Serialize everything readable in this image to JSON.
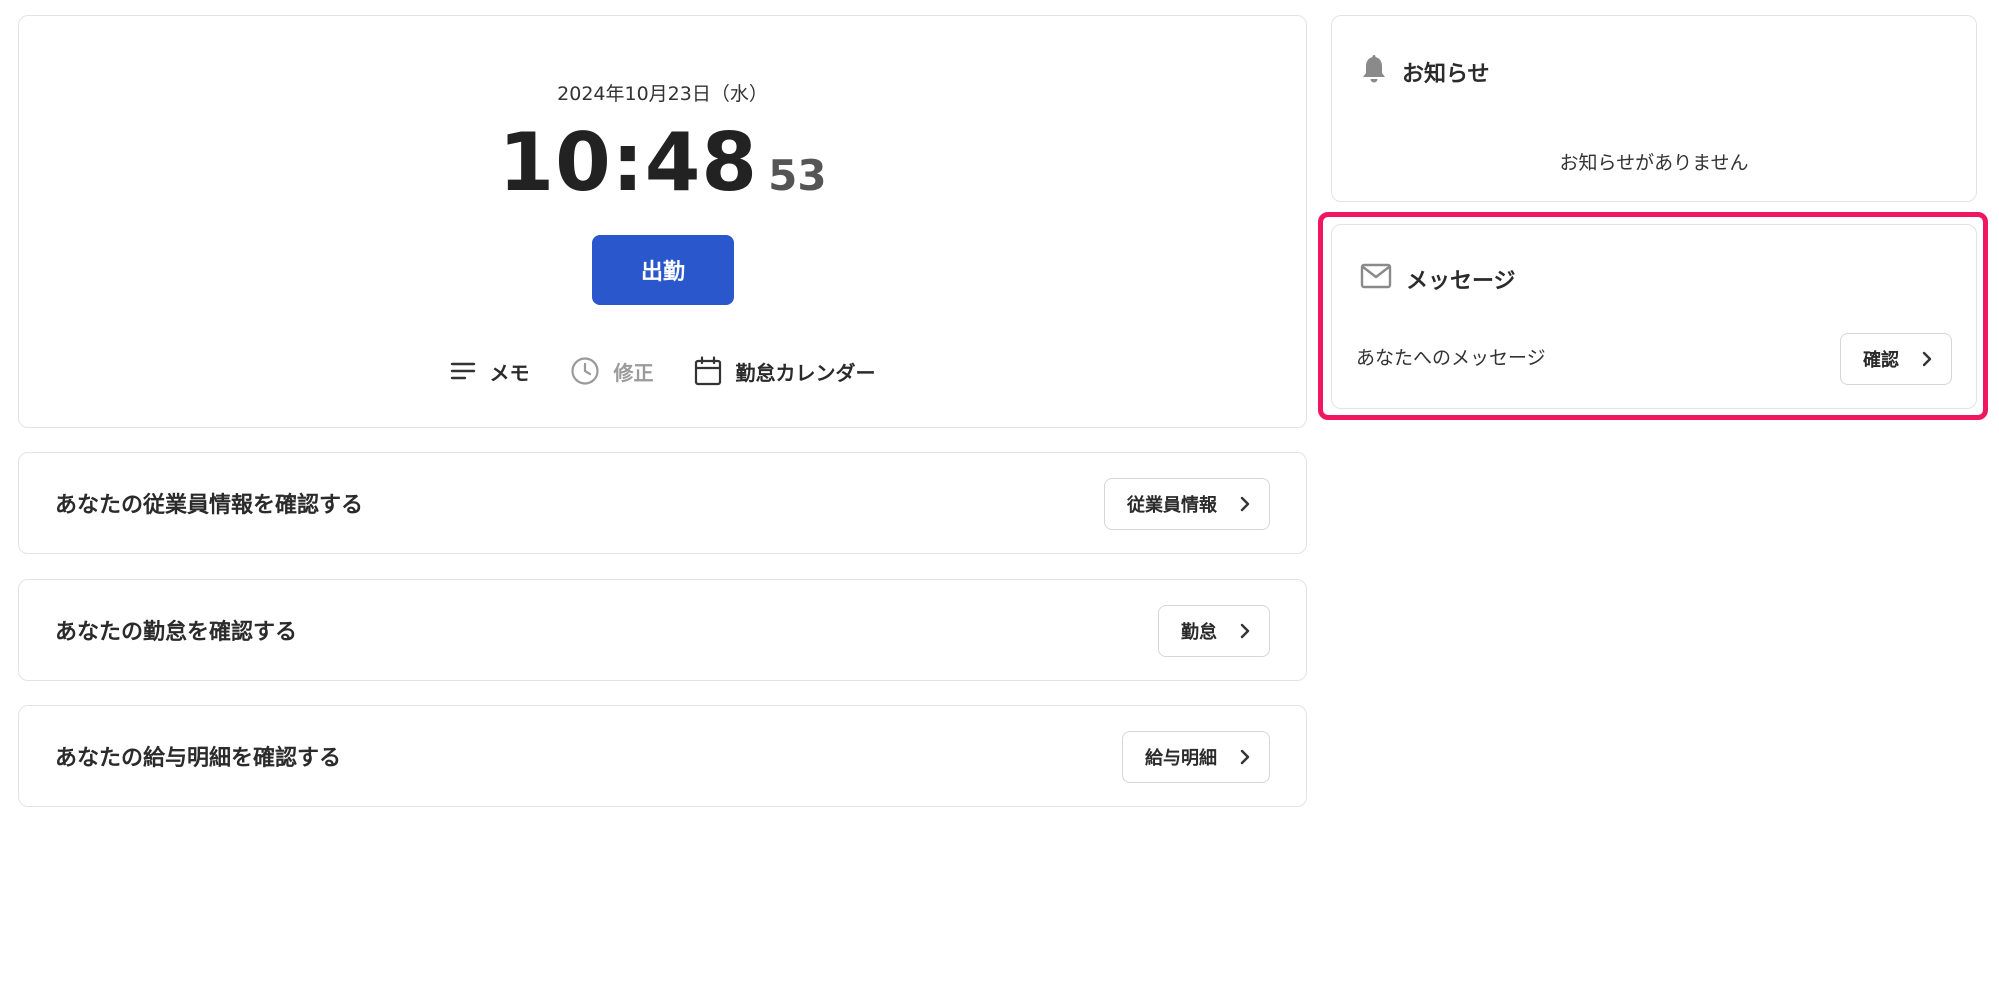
{
  "clock": {
    "date": "2024年10月23日（水）",
    "time_hm": "10:48",
    "time_seconds": "53",
    "punch_label": "出勤",
    "actions": {
      "memo": "メモ",
      "edit": "修正",
      "calendar": "勤怠カレンダー"
    }
  },
  "rows": [
    {
      "label": "あなたの従業員情報を確認する",
      "button": "従業員情報"
    },
    {
      "label": "あなたの勤怠を確認する",
      "button": "勤怠"
    },
    {
      "label": "あなたの給与明細を確認する",
      "button": "給与明細"
    }
  ],
  "notices": {
    "title": "お知らせ",
    "empty_text": "お知らせがありません"
  },
  "messages": {
    "title": "メッセージ",
    "text": "あなたへのメッセージ",
    "button": "確認"
  },
  "colors": {
    "primary": "#2a58cc",
    "highlight": "#f0165f",
    "border": "#e3e3e3",
    "icon_gray": "#8a8a8a"
  },
  "icons": {
    "memo": "lines-icon",
    "edit": "clock-icon",
    "calendar": "calendar-icon",
    "notices": "bell-icon",
    "messages": "mail-icon",
    "chevron": "chevron-right-icon"
  }
}
